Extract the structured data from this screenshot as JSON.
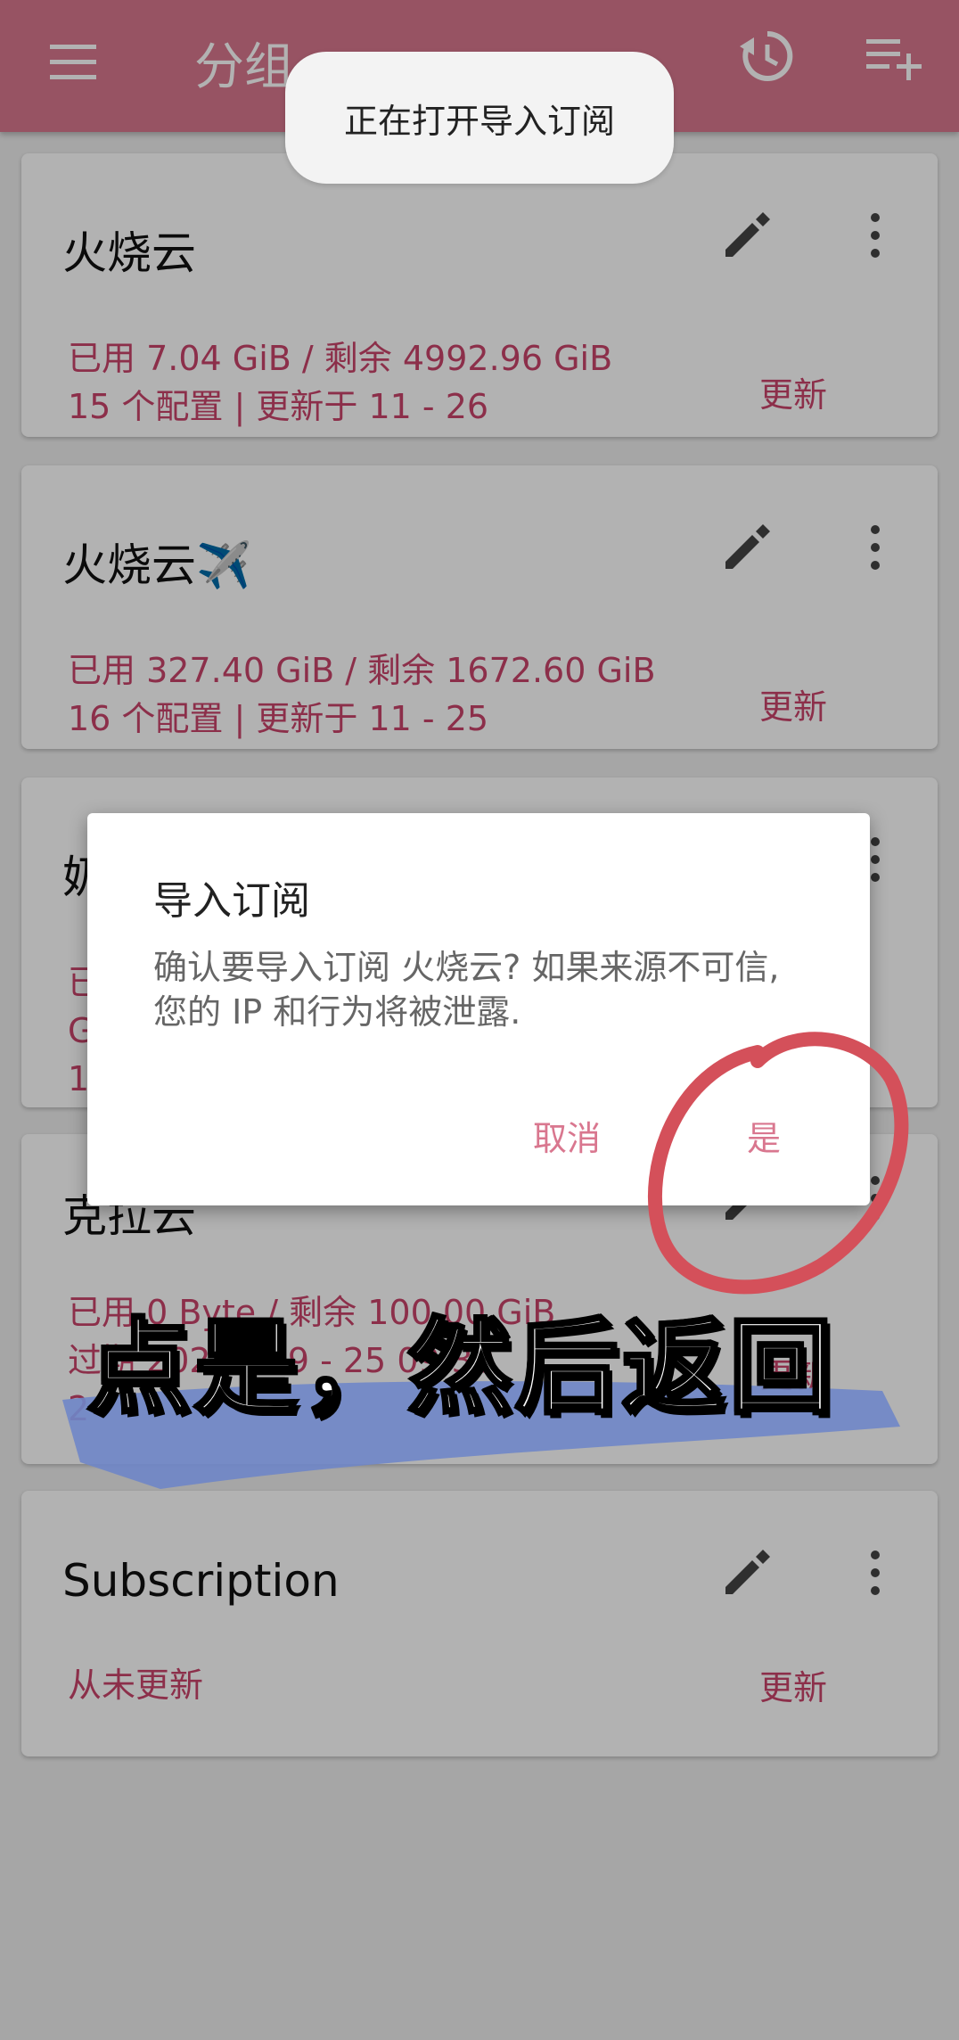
{
  "appbar": {
    "title": "分组",
    "bg": "#d9778f"
  },
  "toast": "正在打开导入订阅",
  "cards": [
    {
      "name": "火烧云",
      "line1": "已用 7.04 GiB / 剩余 4992.96 GiB",
      "line2": "15 个配置 | 更新于 11 - 26",
      "line3": "",
      "update": "更新"
    },
    {
      "name": "火烧云✈️",
      "line1": "已用 327.40 GiB / 剩余 1672.60 GiB",
      "line2": "16 个配置 | 更新于 11 - 25",
      "line3": "",
      "update": "更新"
    },
    {
      "name": "奶",
      "line1": "已",
      "line2": "G",
      "line3": "1",
      "update": "更新"
    },
    {
      "name": "克拉云",
      "line1": "已用 0 Byte / 剩余 100.00 GiB",
      "line2": "过期 2025 - 09 - 25 09:30",
      "line3": "2",
      "update": "更新"
    },
    {
      "name": "Subscription",
      "line1": "从未更新",
      "line2": "",
      "line3": "",
      "update": "更新"
    }
  ],
  "dialog": {
    "title": "导入订阅",
    "message": "确认要导入订阅 火烧云? 如果来源不可信, 您的 IP 和行为将被泄露.",
    "cancel": "取消",
    "confirm": "是"
  },
  "overlay_caption": "点是，然后返回",
  "colors": {
    "accent": "#c9446a",
    "annotation": "#d4505a",
    "brush": "#6f86c8"
  }
}
